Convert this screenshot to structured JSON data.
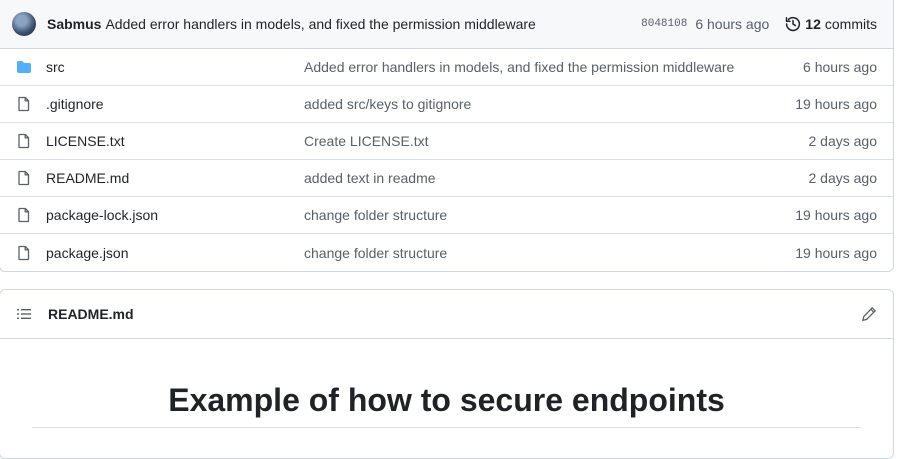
{
  "latest_commit": {
    "author": "Sabmus",
    "message": "Added error handlers in models, and fixed the permission middleware",
    "sha": "8048108",
    "time": "6 hours ago",
    "commits_count": "12",
    "commits_label": "commits"
  },
  "files": [
    {
      "type": "folder",
      "icon": "folder-icon",
      "name": "src",
      "message": "Added error handlers in models, and fixed the permission middleware",
      "time": "6 hours ago"
    },
    {
      "type": "file",
      "icon": "file-icon",
      "name": ".gitignore",
      "message": "added src/keys to gitignore",
      "time": "19 hours ago"
    },
    {
      "type": "file",
      "icon": "file-icon",
      "name": "LICENSE.txt",
      "message": "Create LICENSE.txt",
      "time": "2 days ago"
    },
    {
      "type": "file",
      "icon": "file-icon",
      "name": "README.md",
      "message": "added text in readme",
      "time": "2 days ago"
    },
    {
      "type": "file",
      "icon": "file-icon",
      "name": "package-lock.json",
      "message": "change folder structure",
      "time": "19 hours ago"
    },
    {
      "type": "file",
      "icon": "file-icon",
      "name": "package.json",
      "message": "change folder structure",
      "time": "19 hours ago"
    }
  ],
  "readme": {
    "title": "README.md",
    "heading": "Example of how to secure endpoints"
  },
  "colors": {
    "folder": "#54aeff",
    "muted": "#57606a",
    "border": "#d0d7de"
  }
}
